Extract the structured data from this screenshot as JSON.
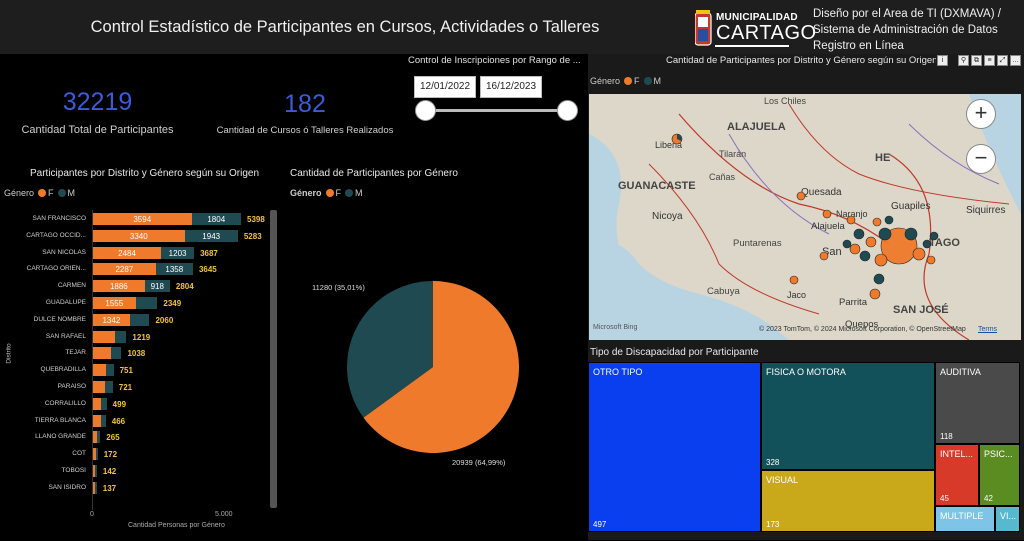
{
  "header": {
    "title": "Control Estadístico de Participantes en Cursos, Actividades o Talleres",
    "logo_top": "MUNICIPALIDAD",
    "logo_main": "CARTAGO",
    "org_line1": "Diseño por el Area de TI (DXMAVA) /",
    "org_line2": "Sistema de Administración de Datos",
    "org_line3": "Registro en Línea"
  },
  "kpis": {
    "total_value": "32219",
    "total_label": "Cantidad Total de Participantes",
    "courses_value": "182",
    "courses_label": "Cantidad de Cursos ó Talleres Realizados"
  },
  "date_filter": {
    "title": "Control de Inscripciones por Rango de ...",
    "start": "12/01/2022",
    "end": "16/12/2023",
    "range_fraction": [
      0,
      1
    ]
  },
  "bar_chart": {
    "title": "Participantes por Distrito y Género según su Origen",
    "legend_title": "Género",
    "legend_f": "F",
    "legend_m": "M",
    "ylabel": "Distrito",
    "xlabel": "Cantidad Personas por Género",
    "x_tick_0": "0",
    "x_tick_5000": "5.000"
  },
  "pie_chart": {
    "title": "Cantidad de Participantes por Género",
    "legend_title": "Género",
    "legend_f": "F",
    "legend_m": "M",
    "label_m": "11280 (35,01%)",
    "label_f": "20939 (64,99%)"
  },
  "map": {
    "title": "Cantidad de Participantes por Distrito y Género según su Origen",
    "legend_title": "Género",
    "legend_f": "F",
    "legend_m": "M",
    "places": {
      "los_chiles": "Los Chiles",
      "alajuela_region": "ALAJUELA",
      "liberia": "Liberia",
      "tilaran": "Tilarán",
      "guanacaste": "GUANACASTE",
      "canas": "Cañas",
      "he": "HE",
      "quesada": "Quesada",
      "nicoya": "Nicoya",
      "naranjo": "Naranjo",
      "guapiles": "Guapiles",
      "siquirres": "Siquirres",
      "alajuela": "Alajuela",
      "puntarenas": "Puntarenas",
      "san": "San",
      "tago": "TAGO",
      "cabuya": "Cabuya",
      "jaco": "Jaco",
      "parrita": "Parrita",
      "san_jose": "SAN JOSÉ",
      "quepos": "Quepos"
    },
    "bing": "Microsoft Bing",
    "copyright": "© 2023 TomTom, © 2024 Microsoft Corporation, © OpenStreetMap",
    "terms": "Terms"
  },
  "treemap": {
    "title": "Tipo de Discapacidad por Participante",
    "items": [
      {
        "label": "OTRO TIPO",
        "value": "497"
      },
      {
        "label": "FISICA O MOTORA",
        "value": "328"
      },
      {
        "label": "VISUAL",
        "value": "173"
      },
      {
        "label": "AUDITIVA",
        "value": "118"
      },
      {
        "label": "INTEL...",
        "value": "45"
      },
      {
        "label": "PSIC...",
        "value": "42"
      },
      {
        "label": "MULTIPLE",
        "value": ""
      },
      {
        "label": "VI...",
        "value": ""
      }
    ]
  },
  "colors": {
    "female": "#f07a2b",
    "male": "#1f4a52",
    "total_label": "#f3c23d",
    "kpi": "#3b5bdb",
    "tm_otro": "#0a3ff0",
    "tm_fisica": "#12505a",
    "tm_visual": "#c9a81a",
    "tm_auditiva": "#4a4a4a",
    "tm_intel": "#d83a2a",
    "tm_psic": "#5a8c22",
    "tm_multiple": "#7ec4e6",
    "tm_vi": "#56b9cf"
  },
  "chart_data": [
    {
      "type": "bar",
      "title": "Participantes por Distrito y Género según su Origen",
      "xlabel": "Cantidad Personas por Género",
      "ylabel": "Distrito",
      "orientation": "horizontal-stacked",
      "xlim": [
        0,
        5500
      ],
      "categories": [
        "SAN FRANCISCO",
        "CARTAGO OCCID...",
        "SAN NICOLAS",
        "CARTAGO ORIEN...",
        "CARMEN",
        "GUADALUPE",
        "DULCE NOMBRE",
        "SAN RAFAEL",
        "TEJAR",
        "QUEBRADILLA",
        "PARAISO",
        "CORRALILLO",
        "TIERRA BLANCA",
        "LLANO GRANDE",
        "COT",
        "TOBOSI",
        "SAN ISIDRO"
      ],
      "series": [
        {
          "name": "F",
          "values": [
            3594,
            3340,
            2484,
            2287,
            1886,
            1555,
            1342,
            805,
            640,
            460,
            440,
            300,
            280,
            160,
            100,
            85,
            82
          ]
        },
        {
          "name": "M",
          "values": [
            1804,
            1943,
            1203,
            1358,
            918,
            794,
            718,
            414,
            398,
            291,
            281,
            199,
            186,
            105,
            72,
            57,
            55
          ]
        }
      ],
      "totals": [
        5398,
        5283,
        3687,
        3645,
        2804,
        2349,
        2060,
        1219,
        1038,
        751,
        721,
        499,
        466,
        265,
        172,
        142,
        137
      ]
    },
    {
      "type": "pie",
      "title": "Cantidad de Participantes por Género",
      "categories": [
        "F",
        "M"
      ],
      "values": [
        20939,
        11280
      ],
      "labels": [
        "20939 (64,99%)",
        "11280 (35,01%)"
      ]
    }
  ]
}
